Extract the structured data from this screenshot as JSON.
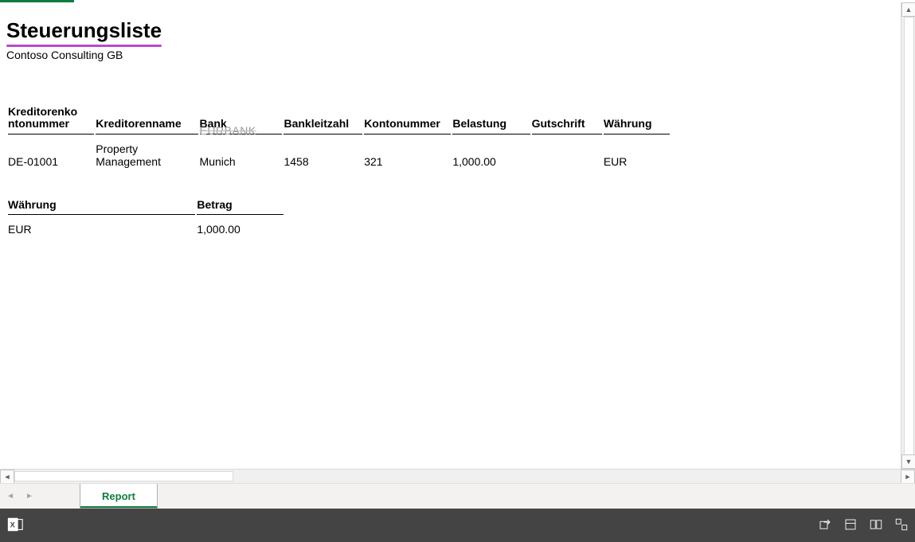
{
  "report": {
    "title": "Steuerungsliste",
    "company": "Contoso Consulting GB",
    "main_headers": {
      "vendor_account": "Kreditorenko\nntonummer",
      "vendor_name": "Kreditorenname",
      "bank": "Bank",
      "routing": "Bankleitzahl",
      "account": "Kontonummer",
      "debit": "Belastung",
      "credit": "Gutschrift",
      "currency": "Währung"
    },
    "bank_ghost": "EURBANK",
    "rows": [
      {
        "vendor_account": "DE-01001",
        "vendor_name": "Property Management",
        "bank": "Munich",
        "routing": "1458",
        "account": "321",
        "debit": "1,000.00",
        "credit": "",
        "currency": "EUR"
      }
    ],
    "summary_headers": {
      "currency": "Währung",
      "amount": "Betrag"
    },
    "summary_rows": [
      {
        "currency": "EUR",
        "amount": "1,000.00"
      }
    ]
  },
  "sheet_tab": "Report"
}
